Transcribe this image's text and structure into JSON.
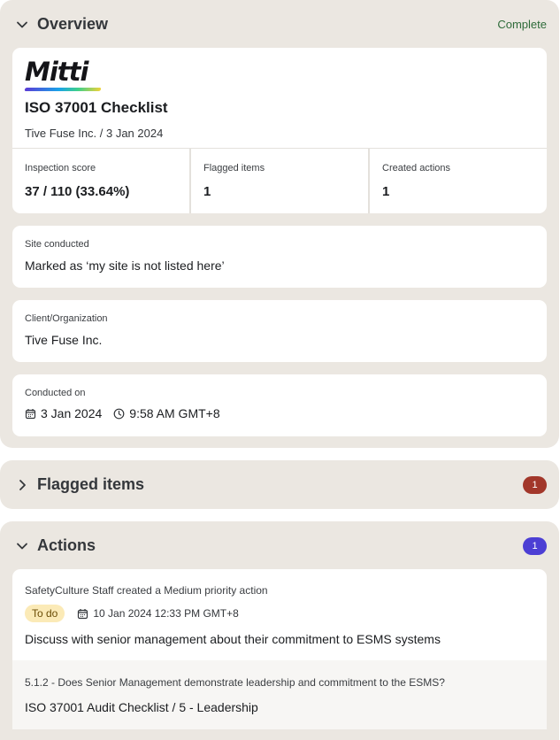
{
  "overview": {
    "title": "Overview",
    "status": "Complete",
    "logo": "Mitti",
    "doc_title": "ISO 37001 Checklist",
    "doc_subtitle": "Tive Fuse Inc. / 3 Jan 2024",
    "stats": [
      {
        "label": "Inspection score",
        "value": "37 / 110 (33.64%)"
      },
      {
        "label": "Flagged items",
        "value": "1"
      },
      {
        "label": "Created actions",
        "value": "1"
      }
    ],
    "site": {
      "label": "Site conducted",
      "value": "Marked as ‘my site is not listed here’"
    },
    "client": {
      "label": "Client/Organization",
      "value": "Tive Fuse Inc."
    },
    "conducted": {
      "label": "Conducted on",
      "date": "3 Jan 2024",
      "time": "9:58 AM GMT+8"
    }
  },
  "flagged": {
    "title": "Flagged items",
    "count": "1"
  },
  "actions": {
    "title": "Actions",
    "count": "1",
    "item": {
      "creator": "SafetyCulture Staff created a Medium priority action",
      "status": "To do",
      "due": "10 Jan 2024 12:33 PM GMT+8",
      "description": "Discuss with senior management about their commitment to ESMS systems",
      "question": "5.1.2 - Does Senior Management demonstrate leadership and commitment to the ESMS?",
      "path": "ISO 37001 Audit Checklist / 5 - Leadership"
    }
  },
  "icons": {
    "chevron_down": "chevron-down-icon",
    "chevron_right": "chevron-right-icon",
    "calendar": "calendar-icon",
    "clock": "clock-icon"
  },
  "colors": {
    "section_bg": "#ebe7e1",
    "complete": "#2f6b3a",
    "flag_badge": "#a2372a",
    "action_badge": "#4c3fd4",
    "todo_pill": "#fbeab7"
  }
}
